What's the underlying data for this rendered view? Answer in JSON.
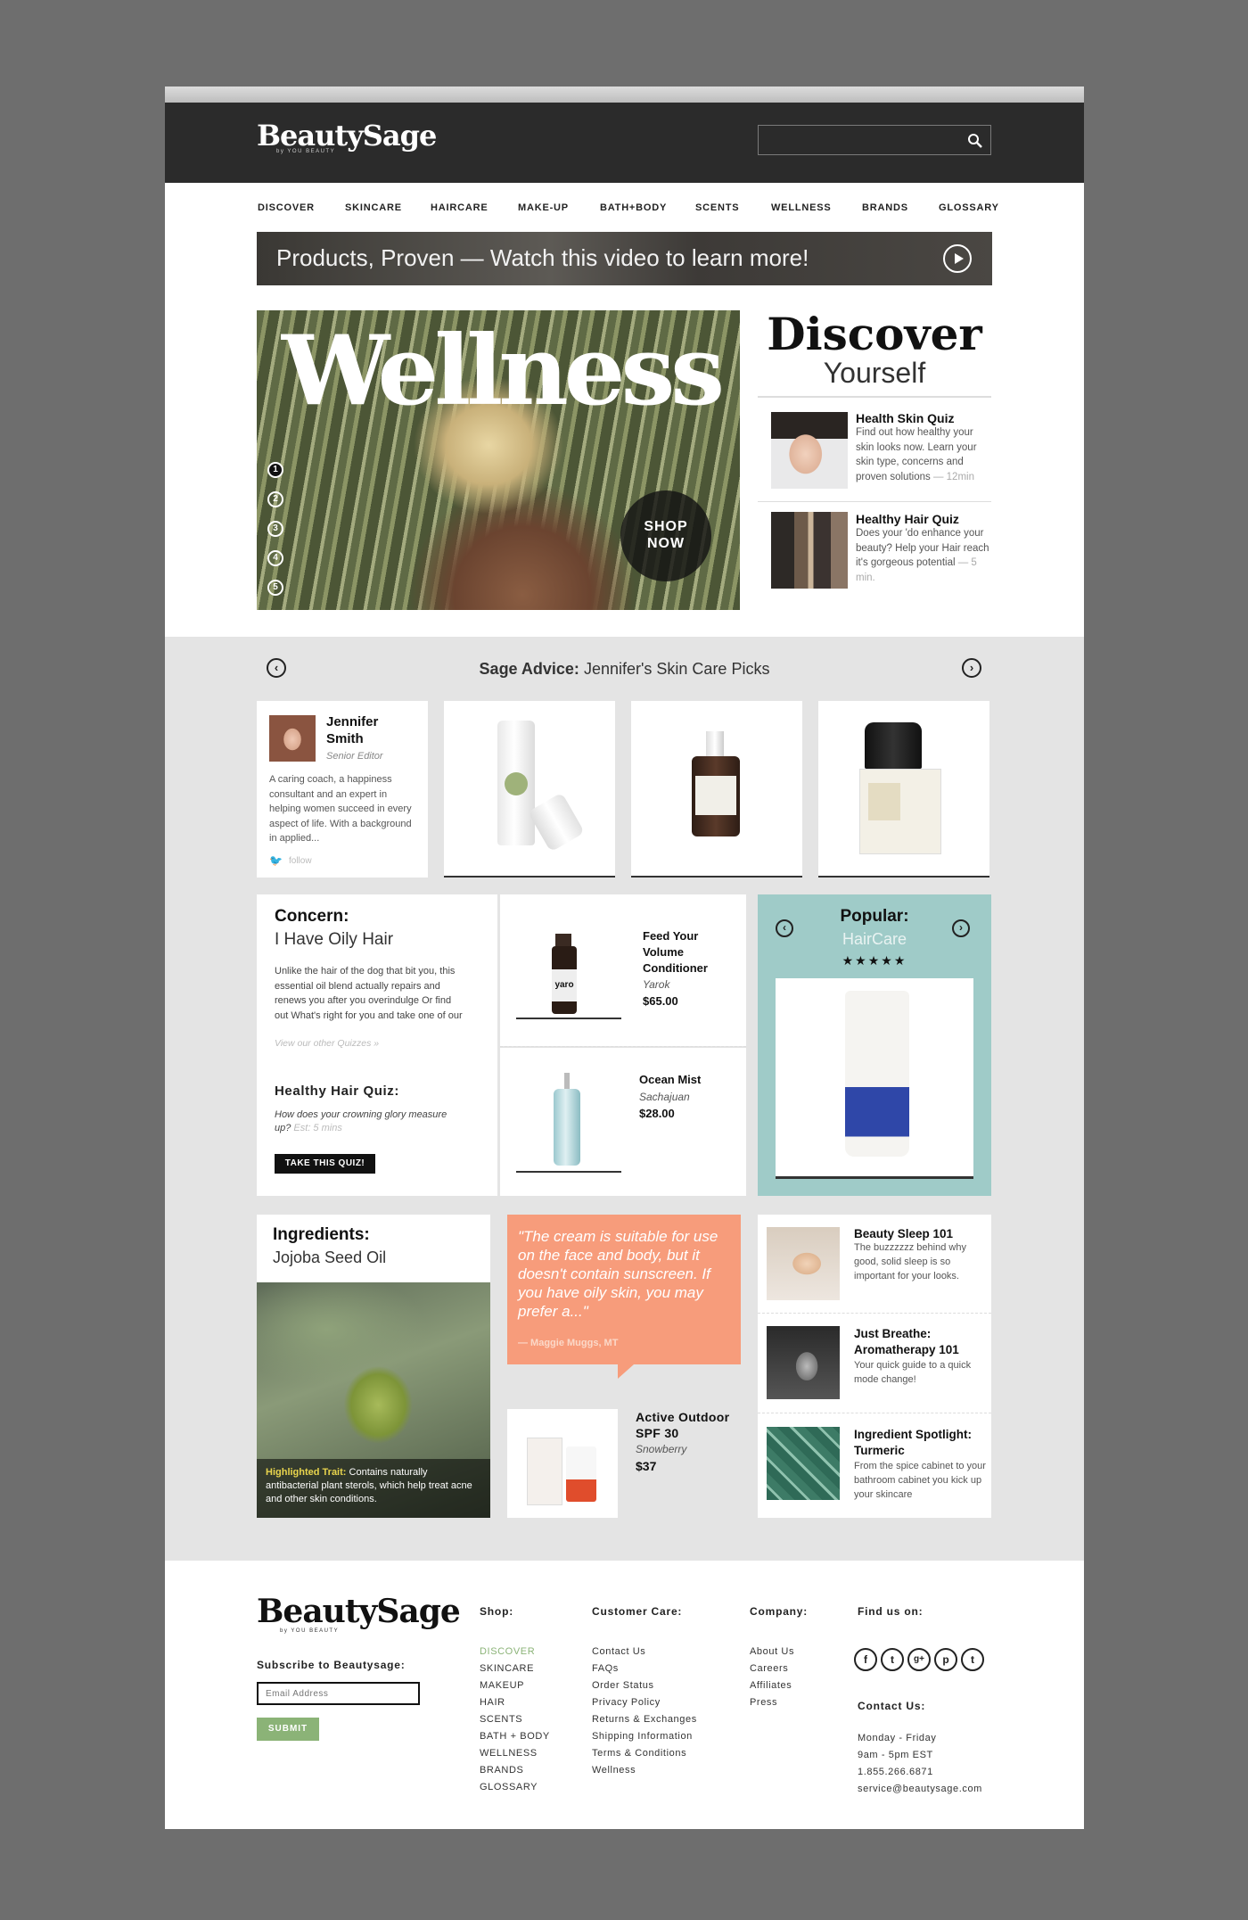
{
  "brand": {
    "name": "BeautySage",
    "tagline": "by YOU BEAUTY"
  },
  "nav": [
    "DISCOVER",
    "SKINCARE",
    "HAIRCARE",
    "MAKE-UP",
    "BATH+BODY",
    "SCENTS",
    "WELLNESS",
    "BRANDS",
    "GLOSSARY"
  ],
  "video_banner": {
    "pre": "Products, ",
    "bold": "Proven",
    "post": " — Watch this video to learn more!"
  },
  "hero": {
    "title": "Wellness",
    "slides": [
      "1",
      "2",
      "3",
      "4",
      "5"
    ],
    "cta_line1": "SHOP",
    "cta_line2": "NOW"
  },
  "discover": {
    "title": "Discover",
    "subtitle": "Yourself",
    "items": [
      {
        "title": "Health Skin Quiz",
        "text": "Find out  how healthy your skin looks now. Learn your skin type, concerns and proven solutions",
        "time": "— 12min"
      },
      {
        "title": "Healthy Hair Quiz",
        "text": "Does your 'do enhance your beauty? Help your Hair reach it's gorgeous potential",
        "time": "— 5 min."
      }
    ]
  },
  "sage_advice": {
    "label": "Sage Advice:",
    "text": " Jennifer's Skin Care Picks",
    "author": {
      "first": "Jennifer",
      "last": "Smith",
      "role": "Senior Editor",
      "bio": "A caring coach, a happiness consultant and an expert in helping women succeed in every aspect of life. With a background in applied...",
      "follow": "follow"
    }
  },
  "concern": {
    "label": "Concern:",
    "title": "I Have Oily Hair",
    "text": "Unlike the hair of the dog that bit you, this essential oil blend actually repairs and renews you after you overindulge Or find out What's right for you and take one of our",
    "link": "View our other Quizzes »",
    "quiz_title": "Healthy Hair Quiz:",
    "quiz_text": "How does your crowning glory measure up?",
    "quiz_time": "Est: 5 mins",
    "quiz_button": "TAKE THIS QUIZ!"
  },
  "products": [
    {
      "name": "Feed Your Volume Conditioner",
      "brand": "Yarok",
      "price": "$65.00"
    },
    {
      "name": "Ocean Mist",
      "brand": "Sachajuan",
      "price": "$28.00"
    }
  ],
  "popular": {
    "label": "Popular:",
    "category": "HairCare",
    "stars": "★★★★★",
    "colors": {
      "bg": "#9fcbc8",
      "category": "#e9f3f2"
    }
  },
  "ingredients": {
    "label": "Ingredients:",
    "title": "Jojoba Seed Oil",
    "trait_label": "Highlighted Trait:",
    "trait_text": " Contains naturally antibacterial plant sterols, which help treat acne and other skin conditions."
  },
  "quote": {
    "text": "\"The cream is suitable for use on the face and body, but it doesn't contain sunscreen. If you have oily skin, you may prefer a...\"",
    "author": "— Maggie Muggs, MT",
    "color": "#f79c7b"
  },
  "spf": {
    "name": "Active Outdoor SPF 30",
    "brand": "Snowberry",
    "price": "$37"
  },
  "articles": [
    {
      "title": "Beauty Sleep 101",
      "text": "The buzzzzzz behind why good, solid sleep is so important for your looks."
    },
    {
      "title": "Just Breathe: Aromatherapy 101",
      "text": "Your quick guide to a quick mode change!"
    },
    {
      "title": "Ingredient Spotlight: Turmeric",
      "text": "From the spice cabinet to your bathroom cabinet you kick up your skincare"
    }
  ],
  "footer": {
    "subscribe_label": "Subscribe to Beautysage:",
    "email_placeholder": "Email Address",
    "submit": "SUBMIT",
    "submit_color": "#8bb377",
    "shop_head": "Shop:",
    "shop": [
      "DISCOVER",
      "SKINCARE",
      "MAKEUP",
      "HAIR",
      "SCENTS",
      "BATH + BODY",
      "WELLNESS",
      "BRANDS",
      "GLOSSARY"
    ],
    "care_head": "Customer Care:",
    "care": [
      "Contact Us",
      "FAQs",
      "Order Status",
      "Privacy Policy",
      "Returns & Exchanges",
      "Shipping Information",
      "Terms & Conditions",
      "Wellness"
    ],
    "company_head": "Company:",
    "company": [
      "About Us",
      "Careers",
      "Affiliates",
      "Press"
    ],
    "find_head": "Find us on:",
    "social": [
      "f",
      "t",
      "g+",
      "p",
      "t"
    ],
    "contact_head": "Contact Us:",
    "contact": [
      "Monday - Friday",
      "9am - 5pm EST",
      "1.855.266.6871",
      "service@beautysage.com"
    ]
  }
}
